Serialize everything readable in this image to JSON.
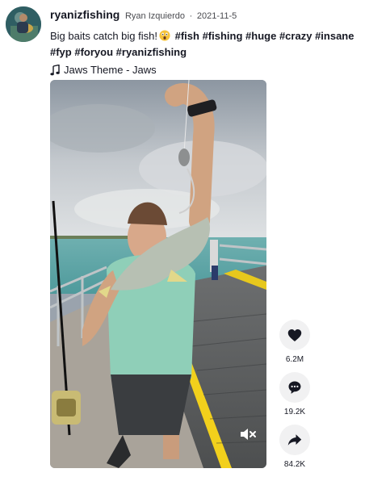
{
  "post": {
    "username": "ryanizfishing",
    "nickname": "Ryan Izquierdo",
    "separator": "·",
    "date": "2021-11-5",
    "caption_text": "Big baits catch big fish!",
    "hashtags": [
      "#fish",
      "#fishing",
      "#huge",
      "#crazy",
      "#insane",
      "#fyp",
      "#foryou",
      "#ryanizfishing"
    ],
    "music": "Jaws Theme - Jaws"
  },
  "actions": {
    "likes": "6.2M",
    "comments": "19.2K",
    "shares": "84.2K"
  },
  "icons": {
    "avatar": "avatar-image",
    "emoji": "astonished-face-icon",
    "music": "music-note-icon",
    "like": "heart-icon",
    "comment": "comment-icon",
    "share": "share-arrow-icon",
    "mute": "muted-speaker-icon"
  }
}
